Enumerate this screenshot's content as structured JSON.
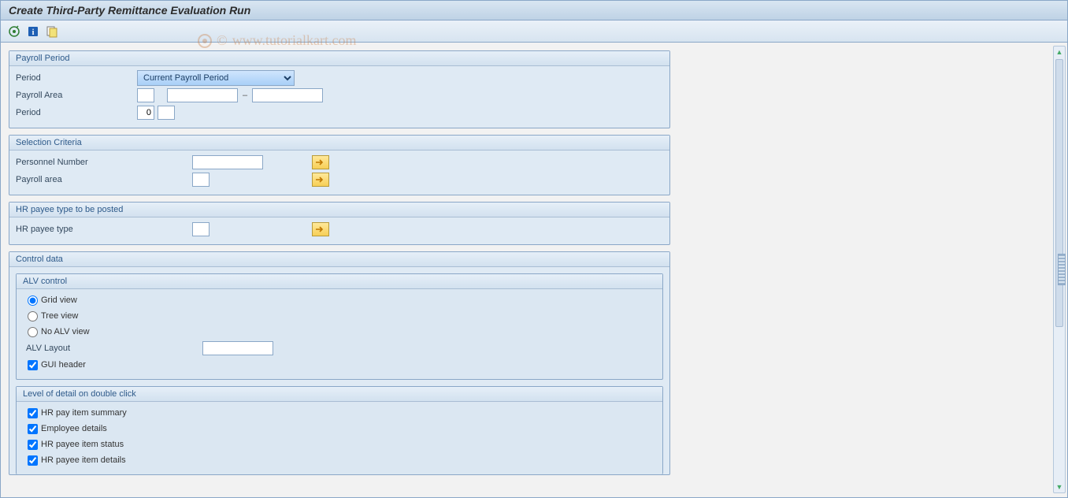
{
  "title": "Create Third-Party Remittance Evaluation Run",
  "watermark": "www.tutorialkart.com",
  "watermark_prefix": "©",
  "toolbar": {
    "icons": [
      "execute-icon",
      "info-icon",
      "variant-icon"
    ]
  },
  "groups": {
    "payroll_period": {
      "title": "Payroll Period",
      "period_label": "Period",
      "period_select_value": "Current Payroll Period",
      "payroll_area_label": "Payroll Area",
      "payroll_area_value": "",
      "range_from": "",
      "range_to": "",
      "period2_label": "Period",
      "period2_num": "0",
      "period2_ext": ""
    },
    "selection": {
      "title": "Selection Criteria",
      "personnel_label": "Personnel Number",
      "personnel_value": "",
      "payroll_area_label": "Payroll area",
      "payroll_area_value": ""
    },
    "hr_payee_type": {
      "title": "HR payee type to be posted",
      "label": "HR payee type",
      "value": ""
    },
    "control": {
      "title": "Control data",
      "alv": {
        "title": "ALV control",
        "grid": "Grid view",
        "tree": "Tree view",
        "noalv": "No ALV view",
        "layout_label": "ALV Layout",
        "layout_value": "",
        "gui_header": "GUI header"
      },
      "detail": {
        "title": "Level of detail on double click",
        "pay_item_summary": "HR pay item summary",
        "employee_details": "Employee details",
        "payee_item_status": "HR payee item status",
        "payee_item_details": "HR payee item details"
      }
    }
  }
}
